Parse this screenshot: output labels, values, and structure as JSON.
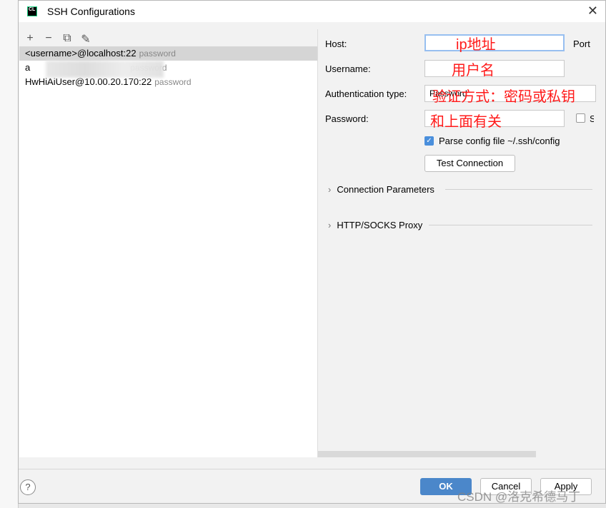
{
  "window": {
    "title": "SSH Configurations",
    "logo": "CL"
  },
  "toolbar": {
    "add": "+",
    "remove": "−",
    "copy": "⧉",
    "edit": "✎"
  },
  "list": [
    {
      "label": "<username>@localhost:22",
      "detail": "password",
      "selected": true
    },
    {
      "label": "a",
      "detail": "password",
      "selected": false
    },
    {
      "label": "HwHiAiUser@10.00.20.170:22",
      "detail": "password",
      "selected": false
    }
  ],
  "form": {
    "host_label": "Host:",
    "port_label": "Port",
    "username_label": "Username:",
    "auth_label": "Authentication type:",
    "auth_value": "Password",
    "password_label": "Password:",
    "save_label": "S",
    "parse_label": "Parse config file ~/.ssh/config",
    "parse_checked": true,
    "test_button": "Test Connection"
  },
  "annotations": {
    "host": "ip地址",
    "username": "用户名",
    "auth": "验证方式：密码或私钥",
    "password": "和上面有关"
  },
  "sections": [
    "Connection Parameters",
    "HTTP/SOCKS Proxy"
  ],
  "footer": {
    "help": "?",
    "ok": "OK",
    "cancel": "Cancel",
    "apply": "Apply"
  },
  "watermark": "CSDN @洛克希德马丁"
}
